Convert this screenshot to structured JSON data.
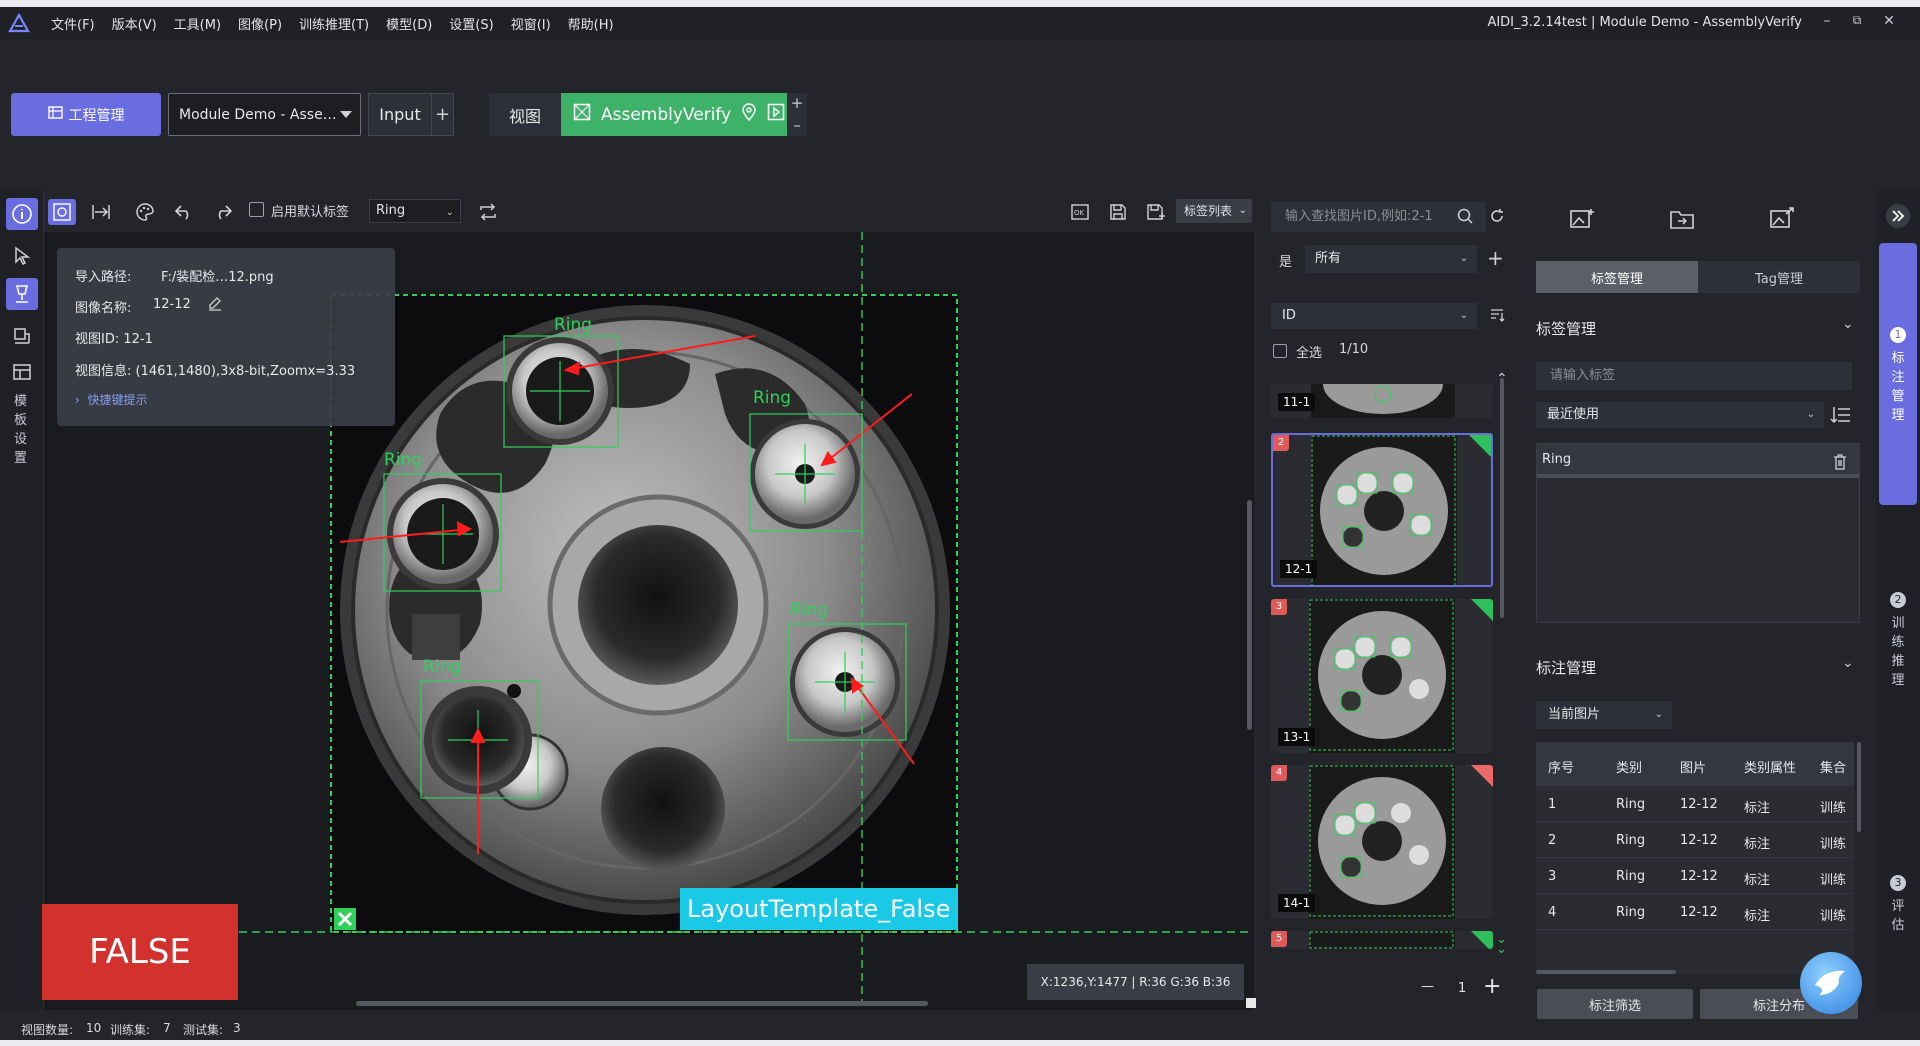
{
  "menu": [
    "文件(F)",
    "版本(V)",
    "工具(M)",
    "图像(P)",
    "训练推理(T)",
    "模型(D)",
    "设置(S)",
    "视窗(I)",
    "帮助(H)"
  ],
  "window": {
    "title": "AIDI_3.2.14test | Module Demo - AssemblyVerify",
    "minimize": "–",
    "restore": "⧉",
    "close": "✕"
  },
  "pipeline": {
    "project_button": "工程管理",
    "project_select": "Module Demo - Asse…",
    "input_node": "Input",
    "add": "+",
    "view_node": "视图",
    "assembly_node": "AssemblyVerify",
    "plus": "+",
    "minus": "–"
  },
  "rail": {
    "template_label": "模板设置"
  },
  "toolbar": {
    "default_label_checkbox": "启用默认标签",
    "label_select": "Ring",
    "tag_list_button": "标签列表"
  },
  "info": {
    "path_label": "导入路径:",
    "path_value": "F:/装配检…12.png",
    "name_label": "图像名称:",
    "name_value": "12-12",
    "view_id": "视图ID: 12-1",
    "view_info": "视图信息: (1461,1480),3x8-bit,Zoomx=3.33",
    "shortcut": "快捷键提示"
  },
  "canvas": {
    "ring_labels": [
      "Ring",
      "Ring",
      "Ring",
      "Ring",
      "Ring"
    ],
    "result": "FALSE",
    "layout_tag": "LayoutTemplate_False",
    "coord": "X:1236,Y:1477 | R:36 G:36 B:36"
  },
  "status": {
    "view_count_label": "视图数量:",
    "view_count": "10",
    "train_label": "训练集:",
    "train": "7",
    "test_label": "测试集:",
    "test": "3"
  },
  "gallery": {
    "search_placeholder": "输入查找图片ID,例如:2-1",
    "yes": "是",
    "filter": "所有",
    "sort": "ID",
    "select_all": "全选",
    "count": "1/10",
    "thumbs": [
      {
        "num": "",
        "id": "11-1"
      },
      {
        "num": "2",
        "id": "12-1"
      },
      {
        "num": "3",
        "id": "13-1"
      },
      {
        "num": "4",
        "id": "14-1"
      },
      {
        "num": "5",
        "id": ""
      }
    ],
    "page": "1",
    "page_minus": "—",
    "page_plus": "+"
  },
  "labels": {
    "tab_label": "标签管理",
    "tab_tag": "Tag管理",
    "section_title": "标签管理",
    "input_placeholder": "请输入标签",
    "recent": "最近使用",
    "items": [
      "Ring"
    ]
  },
  "annotations": {
    "section_title": "标注管理",
    "scope": "当前图片",
    "columns": [
      "序号",
      "类别",
      "图片",
      "类别属性",
      "集合"
    ],
    "rows": [
      [
        "1",
        "Ring",
        "12-12",
        "标注",
        "训练"
      ],
      [
        "2",
        "Ring",
        "12-12",
        "标注",
        "训练"
      ],
      [
        "3",
        "Ring",
        "12-12",
        "标注",
        "训练"
      ],
      [
        "4",
        "Ring",
        "12-12",
        "标注",
        "训练"
      ]
    ],
    "filter_button": "标注筛选",
    "distribution_button": "标注分布"
  },
  "far_rail": {
    "step1_num": "1",
    "step1": "标注管理",
    "step2_num": "2",
    "step2": "训练推理",
    "step3_num": "3",
    "step3": "评估"
  },
  "colors": {
    "accent": "#6a6de0",
    "node_green": "#3fb26a",
    "false_red": "#d3312d",
    "tag_cyan": "#19c9e6",
    "box_green": "#2fd05a"
  }
}
